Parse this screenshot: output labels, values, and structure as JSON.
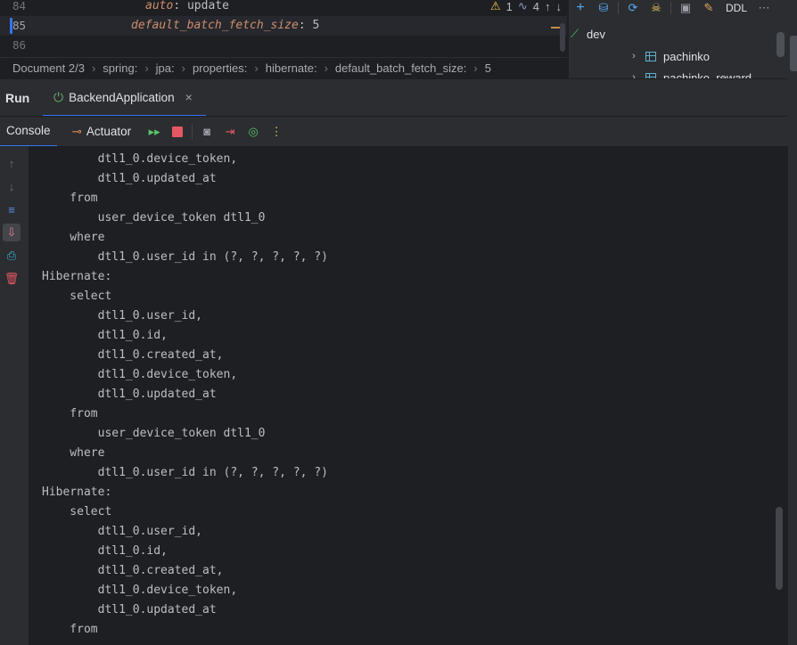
{
  "editor": {
    "lines": [
      {
        "number": "84",
        "key": "auto",
        "value": "update"
      },
      {
        "number": "85",
        "key": "default_batch_fetch_size",
        "value": "5"
      },
      {
        "number": "86",
        "key": "",
        "value": ""
      }
    ],
    "inspections": {
      "warnings": "1",
      "typos": "4"
    }
  },
  "breadcrumb": [
    "Document 2/3",
    "spring:",
    "jpa:",
    "properties:",
    "hibernate:",
    "default_batch_fetch_size:",
    "5"
  ],
  "database": {
    "toolbar_ddl": "DDL",
    "tree": [
      {
        "label": "dev"
      },
      {
        "label": "pachinko"
      },
      {
        "label": "pachinko_reward"
      }
    ]
  },
  "run": {
    "title": "Run",
    "tab_label": "BackendApplication"
  },
  "console_toolbar": {
    "console_tab": "Console",
    "actuator_tab": "Actuator"
  },
  "console": {
    "lines": [
      "        dtl1_0.device_token,",
      "        dtl1_0.updated_at",
      "    from",
      "        user_device_token dtl1_0",
      "    where",
      "        dtl1_0.user_id in (?, ?, ?, ?, ?)",
      "Hibernate:",
      "    select",
      "        dtl1_0.user_id,",
      "        dtl1_0.id,",
      "        dtl1_0.created_at,",
      "        dtl1_0.device_token,",
      "        dtl1_0.updated_at",
      "    from",
      "        user_device_token dtl1_0",
      "    where",
      "        dtl1_0.user_id in (?, ?, ?, ?, ?)",
      "Hibernate:",
      "    select",
      "        dtl1_0.user_id,",
      "        dtl1_0.id,",
      "        dtl1_0.created_at,",
      "        dtl1_0.device_token,",
      "        dtl1_0.updated_at",
      "    from"
    ]
  }
}
